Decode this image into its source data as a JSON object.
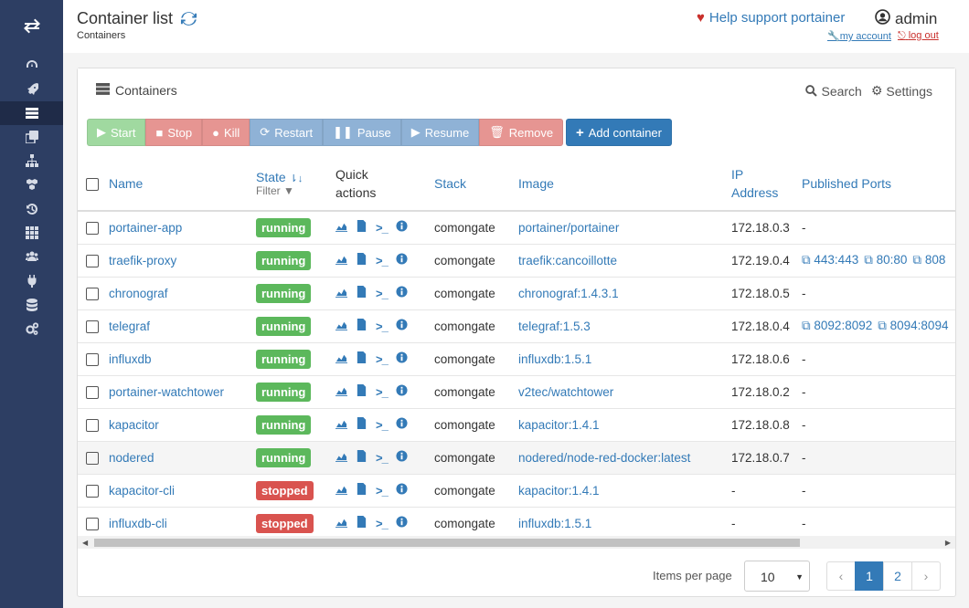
{
  "header": {
    "title": "Container list",
    "breadcrumb": "Containers",
    "support": "Help support portainer",
    "user": "admin",
    "my_account": "my account",
    "logout": "log out"
  },
  "sidebar": {
    "icons": [
      "dashboard-icon",
      "rocket-icon",
      "list-icon",
      "clone-icon",
      "sitemap-icon",
      "cubes-icon",
      "history-icon",
      "th-icon",
      "users-icon",
      "plug-icon",
      "database-icon",
      "cogs-icon"
    ],
    "active_index": 2
  },
  "panel": {
    "title": "Containers",
    "search": "Search",
    "settings": "Settings"
  },
  "toolbar": {
    "start": "Start",
    "stop": "Stop",
    "kill": "Kill",
    "restart": "Restart",
    "pause": "Pause",
    "resume": "Resume",
    "remove": "Remove",
    "add": "Add container"
  },
  "table": {
    "headers": {
      "name": "Name",
      "state": "State",
      "filter": "Filter",
      "quick_actions": "Quick actions",
      "stack": "Stack",
      "image": "Image",
      "ip": "IP Address",
      "ports": "Published Ports"
    },
    "rows": [
      {
        "name": "portainer-app",
        "state": "running",
        "stack": "comongate",
        "image": "portainer/portainer",
        "ip": "172.18.0.3",
        "ports": [
          "-"
        ]
      },
      {
        "name": "traefik-proxy",
        "state": "running",
        "stack": "comongate",
        "image": "traefik:cancoillotte",
        "ip": "172.19.0.4",
        "ports": [
          "443:443",
          "80:80",
          "808"
        ]
      },
      {
        "name": "chronograf",
        "state": "running",
        "stack": "comongate",
        "image": "chronograf:1.4.3.1",
        "ip": "172.18.0.5",
        "ports": [
          "-"
        ]
      },
      {
        "name": "telegraf",
        "state": "running",
        "stack": "comongate",
        "image": "telegraf:1.5.3",
        "ip": "172.18.0.4",
        "ports": [
          "8092:8092",
          "8094:8094"
        ]
      },
      {
        "name": "influxdb",
        "state": "running",
        "stack": "comongate",
        "image": "influxdb:1.5.1",
        "ip": "172.18.0.6",
        "ports": [
          "-"
        ]
      },
      {
        "name": "portainer-watchtower",
        "state": "running",
        "stack": "comongate",
        "image": "v2tec/watchtower",
        "ip": "172.18.0.2",
        "ports": [
          "-"
        ]
      },
      {
        "name": "kapacitor",
        "state": "running",
        "stack": "comongate",
        "image": "kapacitor:1.4.1",
        "ip": "172.18.0.8",
        "ports": [
          "-"
        ]
      },
      {
        "name": "nodered",
        "state": "running",
        "stack": "comongate",
        "image": "nodered/node-red-docker:latest",
        "ip": "172.18.0.7",
        "ports": [
          "-"
        ]
      },
      {
        "name": "kapacitor-cli",
        "state": "stopped",
        "stack": "comongate",
        "image": "kapacitor:1.4.1",
        "ip": "-",
        "ports": [
          "-"
        ]
      },
      {
        "name": "influxdb-cli",
        "state": "stopped",
        "stack": "comongate",
        "image": "influxdb:1.5.1",
        "ip": "-",
        "ports": [
          "-"
        ]
      }
    ],
    "hover_row": 7
  },
  "footer": {
    "items_per_page_label": "Items per page",
    "items_per_page": "10",
    "pages": [
      "1",
      "2"
    ],
    "current_page": "1",
    "prev": "‹",
    "next": "›"
  },
  "colors": {
    "sidebar": "#2d3e63",
    "primary": "#337ab7",
    "running": "#5cb85c",
    "stopped": "#d9534f"
  }
}
